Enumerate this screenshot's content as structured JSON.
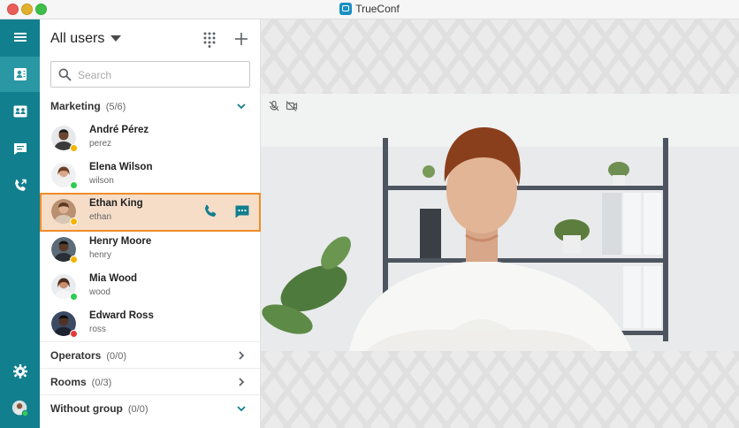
{
  "window": {
    "title": "TrueConf"
  },
  "rail": {
    "items": [
      {
        "icon": "menu-icon"
      },
      {
        "icon": "address-book-icon",
        "active": true
      },
      {
        "icon": "conference-icon"
      },
      {
        "icon": "chat-icon"
      },
      {
        "icon": "call-history-icon"
      }
    ],
    "bottom": [
      {
        "icon": "gear-icon"
      },
      {
        "icon": "user-avatar",
        "status": "online"
      }
    ]
  },
  "panel": {
    "title": "All users",
    "search": {
      "placeholder": "Search",
      "value": ""
    },
    "groups": {
      "marketing": {
        "name": "Marketing",
        "count": "(5/6)",
        "expanded": true
      },
      "operators": {
        "name": "Operators",
        "count": "(0/0)",
        "expanded": false
      },
      "rooms": {
        "name": "Rooms",
        "count": "(0/3)",
        "expanded": false
      },
      "without_group": {
        "name": "Without group",
        "count": "(0/0)",
        "expanded": true
      }
    },
    "contacts": [
      {
        "name": "André Pérez",
        "login": "perez",
        "status": "away",
        "status_color": "#f5b400"
      },
      {
        "name": "Elena Wilson",
        "login": "wilson",
        "status": "online",
        "status_color": "#2fcb52"
      },
      {
        "name": "Ethan King",
        "login": "ethan",
        "status": "away",
        "status_color": "#f5b400",
        "selected": true
      },
      {
        "name": "Henry Moore",
        "login": "henry",
        "status": "away",
        "status_color": "#f5b400"
      },
      {
        "name": "Mia Wood",
        "login": "wood",
        "status": "online",
        "status_color": "#2fcb52"
      },
      {
        "name": "Edward Ross",
        "login": "ross",
        "status": "busy",
        "status_color": "#e53935"
      }
    ]
  },
  "colors": {
    "rail": "#117f8d",
    "accent": "#117f8d",
    "selected_border": "#f08c28",
    "selected_bg": "#f6ddc8"
  }
}
